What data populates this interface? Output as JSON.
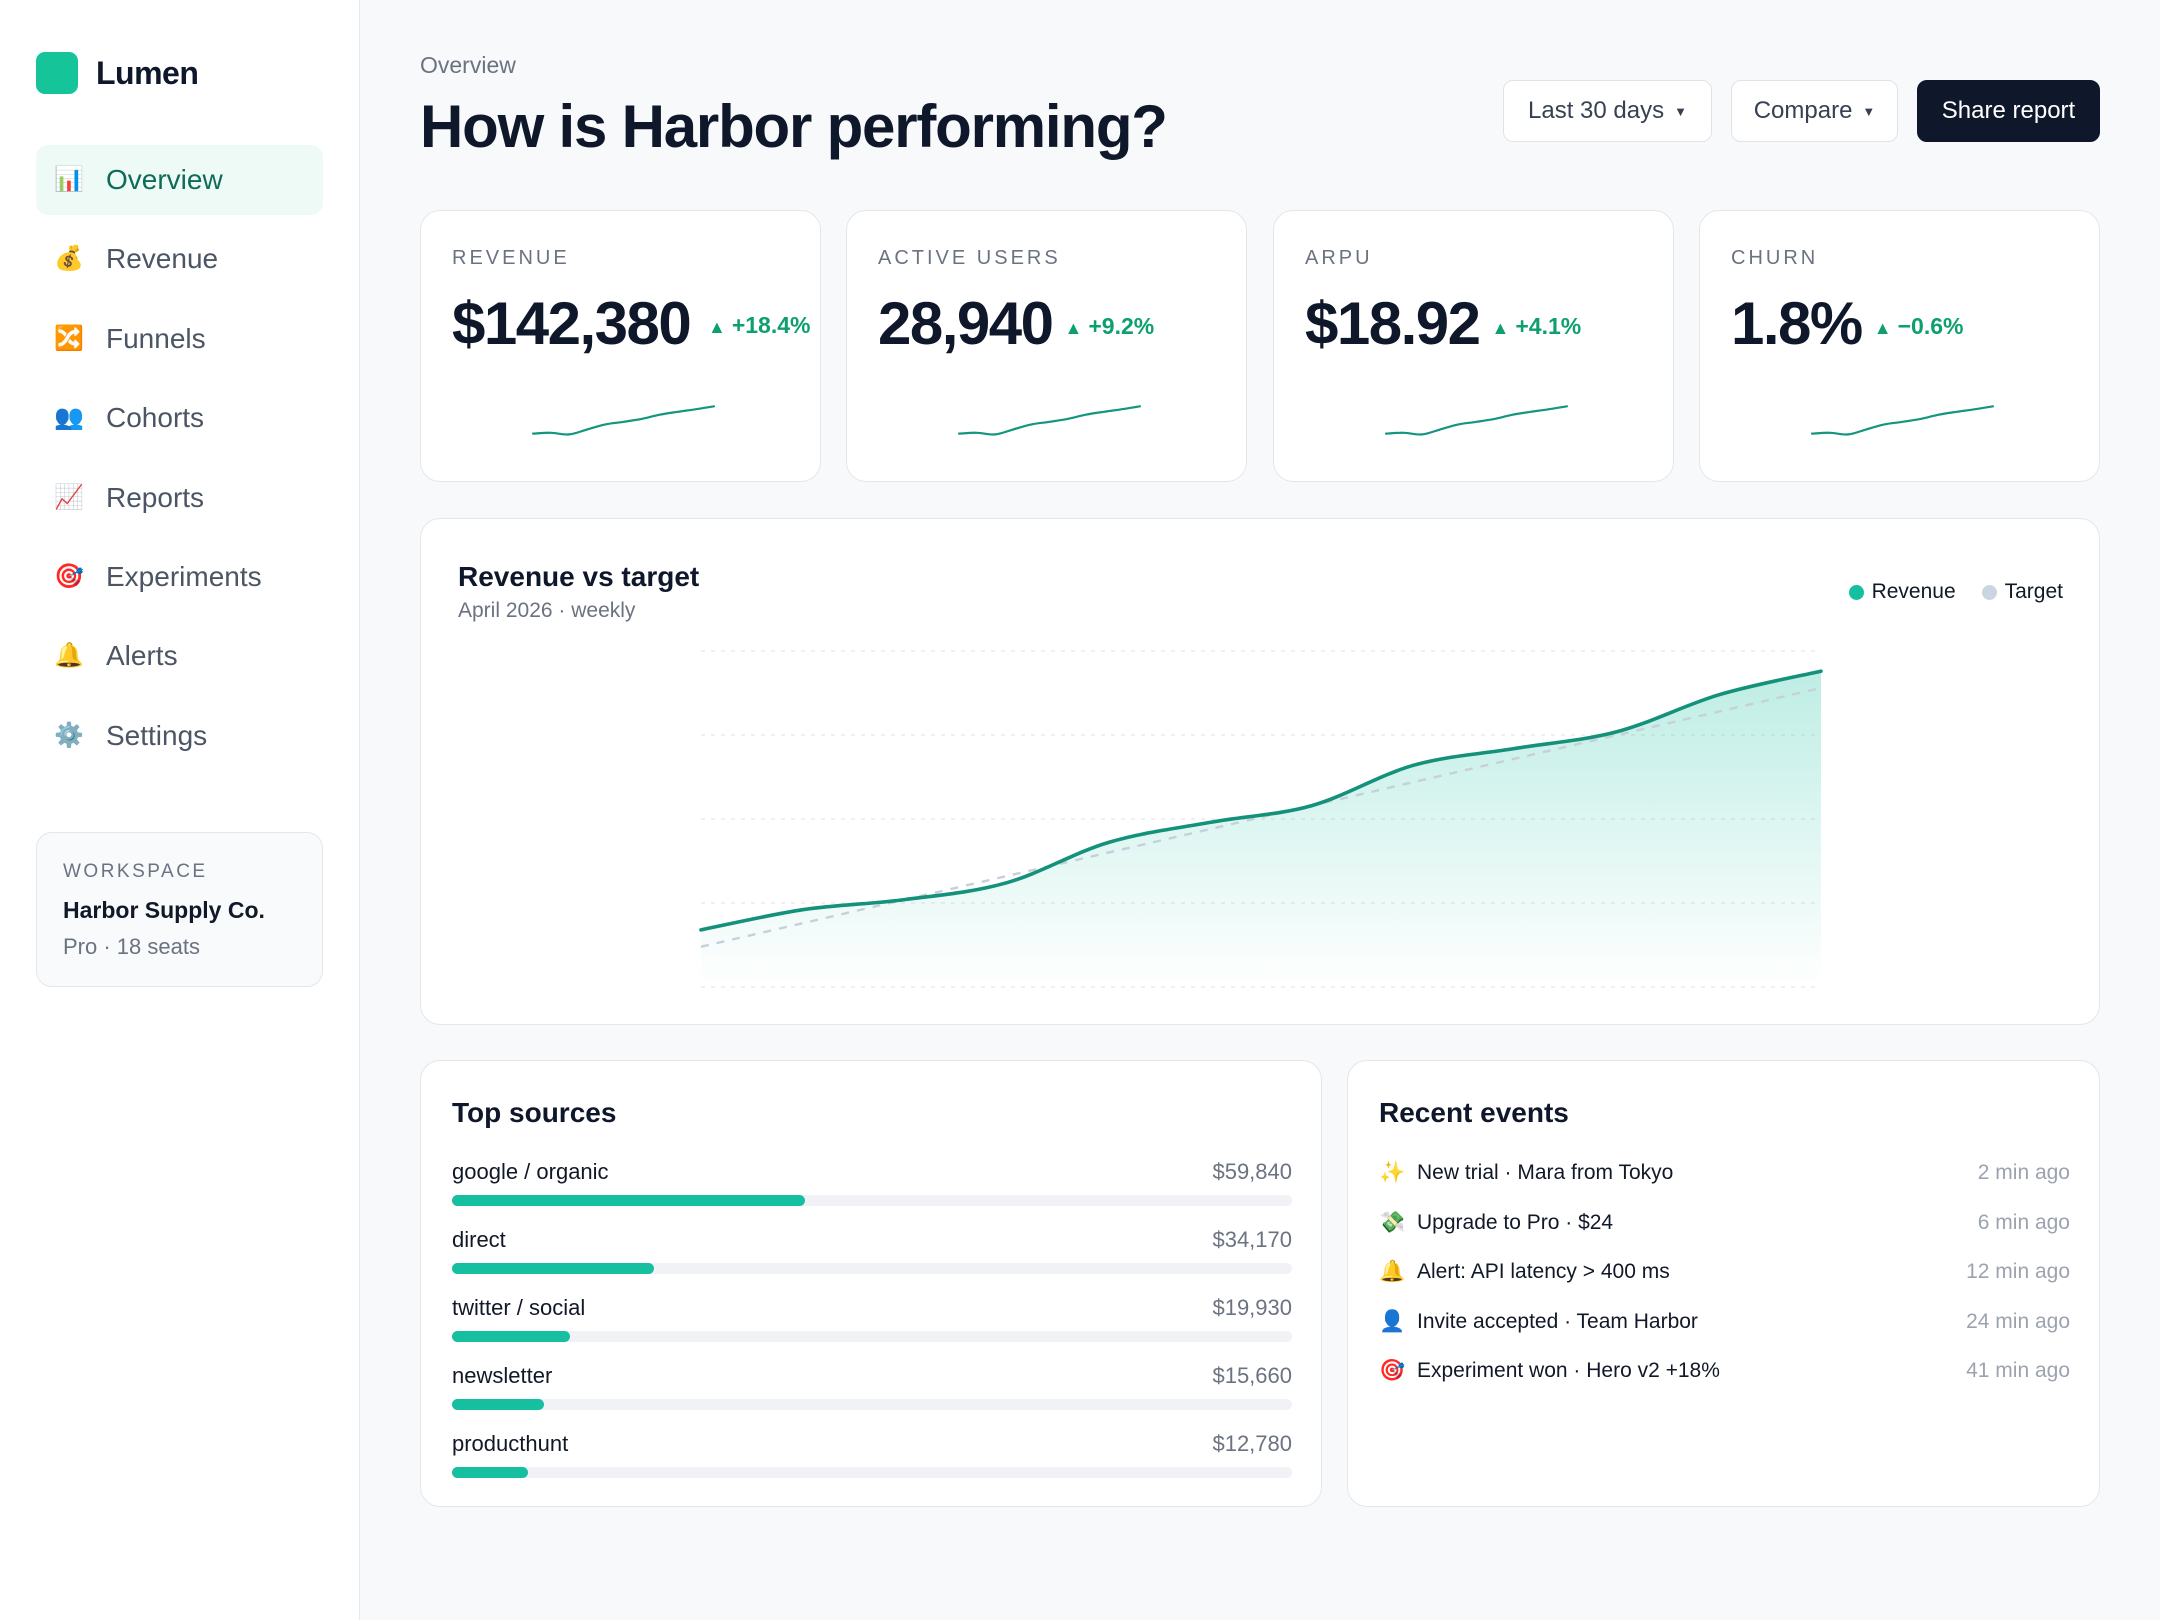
{
  "brand": {
    "name": "Lumen",
    "color": "#16c49a"
  },
  "nav": [
    {
      "label": "Overview",
      "icon": "📊",
      "icon_name": "bar-chart-icon",
      "active": true
    },
    {
      "label": "Revenue",
      "icon": "💰",
      "icon_name": "money-bag-icon"
    },
    {
      "label": "Funnels",
      "icon": "🔀",
      "icon_name": "shuffle-icon"
    },
    {
      "label": "Cohorts",
      "icon": "👥",
      "icon_name": "users-icon"
    },
    {
      "label": "Reports",
      "icon": "📈",
      "icon_name": "trend-chart-icon"
    },
    {
      "label": "Experiments",
      "icon": "🎯",
      "icon_name": "target-icon"
    },
    {
      "label": "Alerts",
      "icon": "🔔",
      "icon_name": "bell-icon"
    },
    {
      "label": "Settings",
      "icon": "⚙️",
      "icon_name": "gear-icon"
    }
  ],
  "workspace": {
    "label": "WORKSPACE",
    "name": "Harbor Supply Co.",
    "plan": "Pro · 18 seats"
  },
  "header": {
    "crumb": "Overview",
    "title": "How is Harbor performing?",
    "range_label": "Last 30 days",
    "compare_label": "Compare",
    "share_label": "Share report"
  },
  "kpis": [
    {
      "label": "REVENUE",
      "value": "$142,380",
      "delta": "+18.4%",
      "trend": [
        0.2,
        0.22,
        0.18,
        0.3,
        0.42,
        0.48,
        0.55,
        0.65,
        0.72,
        0.78,
        0.85
      ]
    },
    {
      "label": "ACTIVE USERS",
      "value": "28,940",
      "delta": "+9.2%",
      "trend": [
        0.2,
        0.22,
        0.18,
        0.3,
        0.42,
        0.48,
        0.55,
        0.65,
        0.72,
        0.78,
        0.85
      ]
    },
    {
      "label": "ARPU",
      "value": "$18.92",
      "delta": "+4.1%",
      "trend": [
        0.2,
        0.22,
        0.18,
        0.3,
        0.42,
        0.48,
        0.55,
        0.65,
        0.72,
        0.78,
        0.85
      ]
    },
    {
      "label": "CHURN",
      "value": "1.8%",
      "delta": "−0.6%",
      "trend": [
        0.2,
        0.22,
        0.18,
        0.3,
        0.42,
        0.48,
        0.55,
        0.65,
        0.72,
        0.78,
        0.85
      ]
    }
  ],
  "chart_data": {
    "type": "area",
    "title": "Revenue vs target",
    "subtitle": "April 2026 · weekly",
    "legend": "top-right",
    "grid": true,
    "ylim": [
      0,
      100
    ],
    "series": [
      {
        "name": "Revenue",
        "color": "#16bfa0",
        "values": [
          17,
          23,
          26,
          31,
          43,
          49,
          54,
          66,
          71,
          76,
          87,
          94
        ]
      },
      {
        "name": "Target",
        "color": "#cbd5e1",
        "values": [
          12,
          19,
          26,
          33,
          40,
          47,
          54,
          61,
          68,
          75,
          82,
          89
        ]
      }
    ]
  },
  "sources": {
    "title": "Top sources",
    "items": [
      {
        "name": "google / organic",
        "value": "$59,840",
        "share": 0.42
      },
      {
        "name": "direct",
        "value": "$34,170",
        "share": 0.24
      },
      {
        "name": "twitter / social",
        "value": "$19,930",
        "share": 0.14
      },
      {
        "name": "newsletter",
        "value": "$15,660",
        "share": 0.11
      },
      {
        "name": "producthunt",
        "value": "$12,780",
        "share": 0.09
      }
    ]
  },
  "events": {
    "title": "Recent events",
    "items": [
      {
        "icon": "✨",
        "icon_name": "sparkles-icon",
        "text": "New trial · Mara from Tokyo",
        "time": "2 min ago"
      },
      {
        "icon": "💸",
        "icon_name": "money-wings-icon",
        "text": "Upgrade to Pro · $24",
        "time": "6 min ago"
      },
      {
        "icon": "🔔",
        "icon_name": "bell-icon",
        "text": "Alert: API latency > 400 ms",
        "time": "12 min ago"
      },
      {
        "icon": "👤",
        "icon_name": "user-icon",
        "text": "Invite accepted · Team Harbor",
        "time": "24 min ago"
      },
      {
        "icon": "🎯",
        "icon_name": "target-icon",
        "text": "Experiment won · Hero v2 +18%",
        "time": "41 min ago"
      }
    ]
  }
}
